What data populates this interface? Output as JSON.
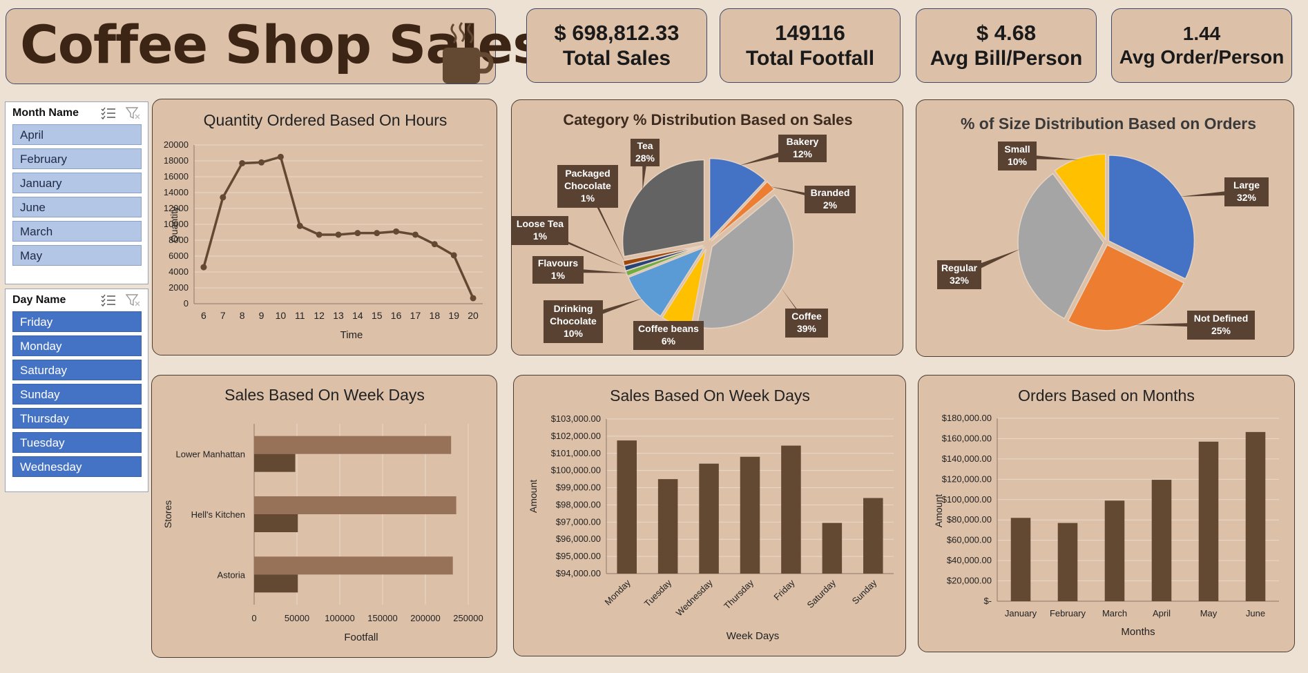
{
  "dashboard_title": "Coffee Shop Sales",
  "kpis": [
    {
      "value": "$ 698,812.33",
      "label": "Total Sales"
    },
    {
      "value": "149116",
      "label": "Total Footfall"
    },
    {
      "value": "$ 4.68",
      "label": "Avg Bill/Person"
    },
    {
      "value": "1.44",
      "label": "Avg Order/Person"
    }
  ],
  "slicers": {
    "month": {
      "title": "Month Name",
      "items": [
        "April",
        "February",
        "January",
        "June",
        "March",
        "May"
      ]
    },
    "day": {
      "title": "Day Name",
      "items": [
        "Friday",
        "Monday",
        "Saturday",
        "Sunday",
        "Thursday",
        "Tuesday",
        "Wednesday"
      ]
    }
  },
  "colors": {
    "brown": "#634832",
    "light_brown": "#977158",
    "card": "#dcc0a8",
    "label_box": "#5a4232"
  },
  "chart_data": [
    {
      "id": "hours",
      "type": "line",
      "title": "Quantity Ordered Based On Hours",
      "xlabel": "Time",
      "ylabel": "Quantity",
      "x": [
        6,
        7,
        8,
        9,
        10,
        11,
        12,
        13,
        14,
        15,
        16,
        17,
        18,
        19,
        20
      ],
      "values": [
        4600,
        13400,
        17700,
        17800,
        18500,
        9800,
        8700,
        8700,
        8900,
        8900,
        9100,
        8700,
        7500,
        6100,
        700
      ],
      "ylim": [
        0,
        20000
      ],
      "yticks": [
        "0",
        "2000",
        "4000",
        "6000",
        "8000",
        "10000",
        "12000",
        "14000",
        "16000",
        "18000",
        "20000"
      ]
    },
    {
      "id": "category",
      "type": "pie",
      "title": "Category % Distribution Based on Sales",
      "slices": [
        {
          "label": "Bakery",
          "pct": "12%",
          "value": 12,
          "color": "#4472c4"
        },
        {
          "label": "Branded",
          "pct": "2%",
          "value": 2,
          "color": "#ed7d31"
        },
        {
          "label": "Coffee",
          "pct": "39%",
          "value": 39,
          "color": "#a5a5a5"
        },
        {
          "label": "Coffee beans",
          "pct": "6%",
          "value": 6,
          "color": "#ffc000"
        },
        {
          "label": "Drinking Chocolate",
          "pct": "10%",
          "value": 10,
          "color": "#5b9bd5"
        },
        {
          "label": "Flavours",
          "pct": "1%",
          "value": 1,
          "color": "#70ad47"
        },
        {
          "label": "Loose Tea",
          "pct": "1%",
          "value": 1,
          "color": "#264478"
        },
        {
          "label": "Packaged Chocolate",
          "pct": "1%",
          "value": 1,
          "color": "#9e480e"
        },
        {
          "label": "Tea",
          "pct": "28%",
          "value": 28,
          "color": "#636363"
        }
      ]
    },
    {
      "id": "size",
      "type": "pie",
      "title": "% of Size Distribution Based on Orders",
      "slices": [
        {
          "label": "Large",
          "pct": "32%",
          "value": 32,
          "color": "#4472c4"
        },
        {
          "label": "Not Defined",
          "pct": "25%",
          "value": 25,
          "color": "#ed7d31"
        },
        {
          "label": "Regular",
          "pct": "32%",
          "value": 32,
          "color": "#a5a5a5"
        },
        {
          "label": "Small",
          "pct": "10%",
          "value": 10,
          "color": "#ffc000"
        }
      ]
    },
    {
      "id": "stores",
      "type": "bar",
      "orientation": "horizontal",
      "title": "Sales Based On Week Days",
      "xlabel": "Footfall",
      "ylabel": "Stores",
      "categories": [
        "Lower Manhattan",
        "Hell's Kitchen",
        "Astoria"
      ],
      "series": [
        {
          "values": [
            230000,
            236000,
            232000
          ],
          "color": "#977158"
        },
        {
          "values": [
            48000,
            51000,
            51000
          ],
          "color": "#634832"
        }
      ],
      "xlim": [
        0,
        250000
      ],
      "xticks": [
        "0",
        "50000",
        "100000",
        "150000",
        "200000",
        "250000"
      ]
    },
    {
      "id": "weekdays",
      "type": "bar",
      "title": "Sales Based On Week Days",
      "xlabel": "Week Days",
      "ylabel": "Amount",
      "categories": [
        "Monday",
        "Tuesday",
        "Wednesday",
        "Thursday",
        "Friday",
        "Saturday",
        "Sunday"
      ],
      "values": [
        101750,
        99500,
        100400,
        100800,
        101450,
        96950,
        98400
      ],
      "ylim": [
        94000,
        103000
      ],
      "yticks": [
        "$94,000.00",
        "$95,000.00",
        "$96,000.00",
        "$97,000.00",
        "$98,000.00",
        "$99,000.00",
        "$100,000.00",
        "$101,000.00",
        "$102,000.00",
        "$103,000.00"
      ]
    },
    {
      "id": "months",
      "type": "bar",
      "title": "Orders Based on Months",
      "xlabel": "Months",
      "ylabel": "Amount",
      "categories": [
        "January",
        "February",
        "March",
        "April",
        "May",
        "June"
      ],
      "values": [
        82000,
        77000,
        99000,
        119500,
        157000,
        166500
      ],
      "ylim": [
        0,
        180000
      ],
      "yticks": [
        "$-",
        "$20,000.00",
        "$40,000.00",
        "$60,000.00",
        "$80,000.00",
        "$100,000.00",
        "$120,000.00",
        "$140,000.00",
        "$160,000.00",
        "$180,000.00"
      ]
    }
  ]
}
